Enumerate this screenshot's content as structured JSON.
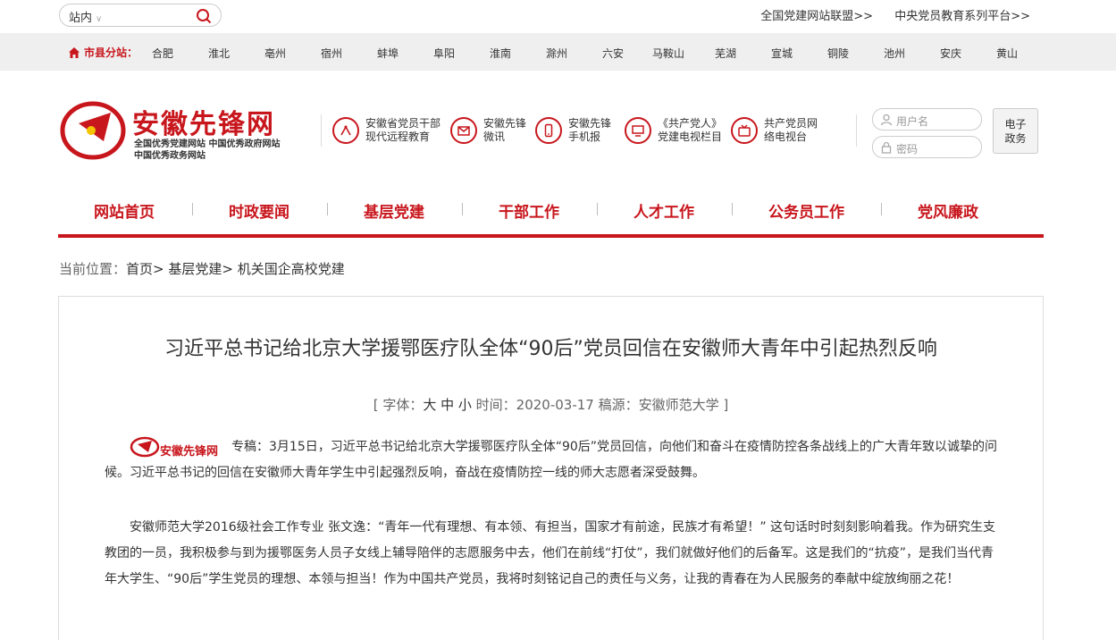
{
  "search": {
    "scope": "站内"
  },
  "top_links": [
    "全国党建网站联盟>>",
    "中央党员教育系列平台>>"
  ],
  "cities": {
    "label": "市县分站：",
    "items": [
      "合肥",
      "淮北",
      "亳州",
      "宿州",
      "蚌埠",
      "阜阳",
      "淮南",
      "滁州",
      "六安",
      "马鞍山",
      "芜湖",
      "宣城",
      "铜陵",
      "池州",
      "安庆",
      "黄山"
    ]
  },
  "logo": {
    "title": "安徽先锋网",
    "sub1": "全国优秀党建网站 中国优秀政府网站",
    "sub2": "中国优秀政务网站"
  },
  "quick_links": [
    {
      "line1": "安徽省党员干部",
      "line2": "现代远程教育",
      "icon": "antenna-icon"
    },
    {
      "line1": "安徽先锋",
      "line2": "微讯",
      "icon": "mail-icon"
    },
    {
      "line1": "安徽先锋",
      "line2": "手机报",
      "icon": "phone-icon"
    },
    {
      "line1": "《共产党人》",
      "line2": "党建电视栏目",
      "icon": "monitor-icon"
    },
    {
      "line1": "共产党员网",
      "line2": "络电视台",
      "icon": "tv-icon"
    }
  ],
  "login": {
    "username_placeholder": "用户名",
    "password_placeholder": "密码",
    "egov_line1": "电子",
    "egov_line2": "政务"
  },
  "nav": [
    "网站首页",
    "时政要闻",
    "基层党建",
    "干部工作",
    "人才工作",
    "公务员工作",
    "党风廉政"
  ],
  "breadcrumb": {
    "prefix": "当前位置：",
    "path": "首页> 基层党建> 机关国企高校党建"
  },
  "article": {
    "title": "习近平总书记给北京大学援鄂医疗队全体“90后”党员回信在安徽师大青年中引起热烈反响",
    "meta_open": "[ 字体：",
    "font_sizes": "大 中 小",
    "meta_rest": " 时间：2020-03-17 稿源：安徽师范大学 ]",
    "inline_logo": "安徽先锋网",
    "para1": "专稿：3月15日，习近平总书记给北京大学援鄂医疗队全体“90后”党员回信，向他们和奋斗在疫情防控各条战线上的广大青年致以诚挚的问候。习近平总书记的回信在安徽师大青年学生中引起强烈反响，奋战在疫情防控一线的师大志愿者深受鼓舞。",
    "para2": "安徽师范大学2016级社会工作专业 张文逸：“青年一代有理想、有本领、有担当，国家才有前途，民族才有希望！” 这句话时时刻刻影响着我。作为研究生支教团的一员，我积极参与到为援鄂医务人员子女线上辅导陪伴的志愿服务中去，他们在前线“打仗”，我们就做好他们的后备军。这是我们的“抗疫”，是我们当代青年大学生、“90后”学生党员的理想、本领与担当！作为中国共产党员，我将时刻铭记自己的责任与义务，让我的青春在为人民服务的奉献中绽放绚丽之花！"
  }
}
